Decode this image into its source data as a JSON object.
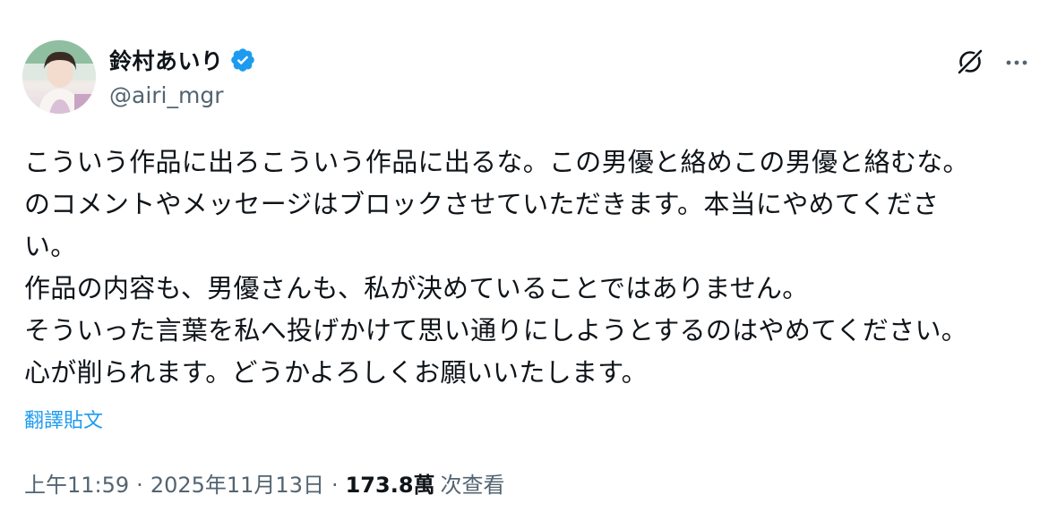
{
  "author": {
    "display_name": "鈴村あいり",
    "handle": "@airi_mgr",
    "verified": true,
    "avatar": "user-avatar-photo"
  },
  "header_actions": {
    "grok_icon": "grok-icon",
    "more_icon": "more-icon"
  },
  "body": {
    "lines": [
      "こういう作品に出ろこういう作品に出るな。この男優と絡めこの男優と絡むな。",
      "のコメントやメッセージはブロックさせていただきます。本当にやめてくださ",
      "い。",
      "作品の内容も、男優さんも、私が決めていることではありません。",
      "そういった言葉を私へ投げかけて思い通りにしようとするのはやめてください。",
      "心が削られます。どうかよろしくお願いいたします。"
    ]
  },
  "translate_label": "翻譯貼文",
  "meta": {
    "time": "上午11:59",
    "separator": "·",
    "date": "2025年11月13日",
    "views_count": "173.8萬",
    "views_label": "次查看"
  },
  "colors": {
    "text": "#0f1419",
    "secondary": "#536471",
    "link": "#1d9bf0",
    "verified_badge": "#1d9bf0"
  }
}
